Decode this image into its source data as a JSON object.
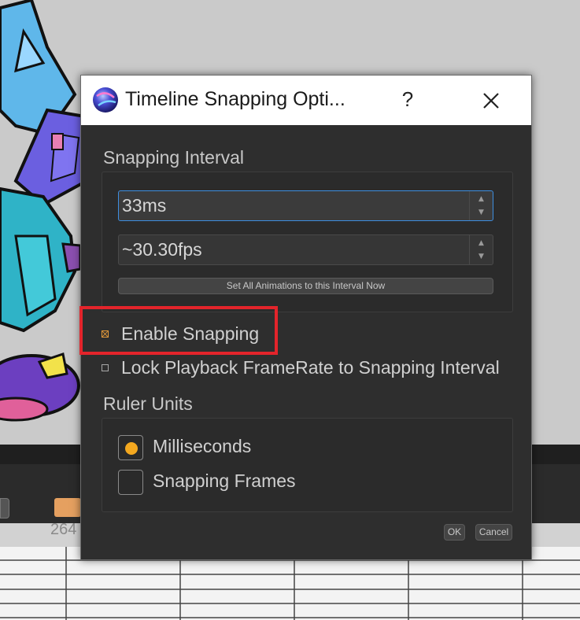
{
  "dialog": {
    "title": "Timeline Snapping Opti...",
    "help_label": "?",
    "interval_section_label": "Snapping Interval",
    "interval_ms_value": "33ms",
    "interval_fps_value": "~30.30fps",
    "apply_button_label": "Set All Animations to this Interval Now",
    "enable_snapping_label": "Enable Snapping",
    "enable_snapping_checked": true,
    "lock_playback_label": "Lock Playback FrameRate to Snapping Interval",
    "lock_playback_checked": false,
    "ruler_section_label": "Ruler Units",
    "ruler_units": [
      {
        "label": "Milliseconds",
        "selected": true
      },
      {
        "label": "Snapping Frames",
        "selected": false
      }
    ],
    "ok_label": "OK",
    "cancel_label": "Cancel"
  },
  "background": {
    "ruler_text": "264"
  },
  "colors": {
    "accent": "#f4a81f",
    "highlight": "#e3242b",
    "focus": "#3d8ee0",
    "dialog_bg": "#2e2e2e"
  }
}
